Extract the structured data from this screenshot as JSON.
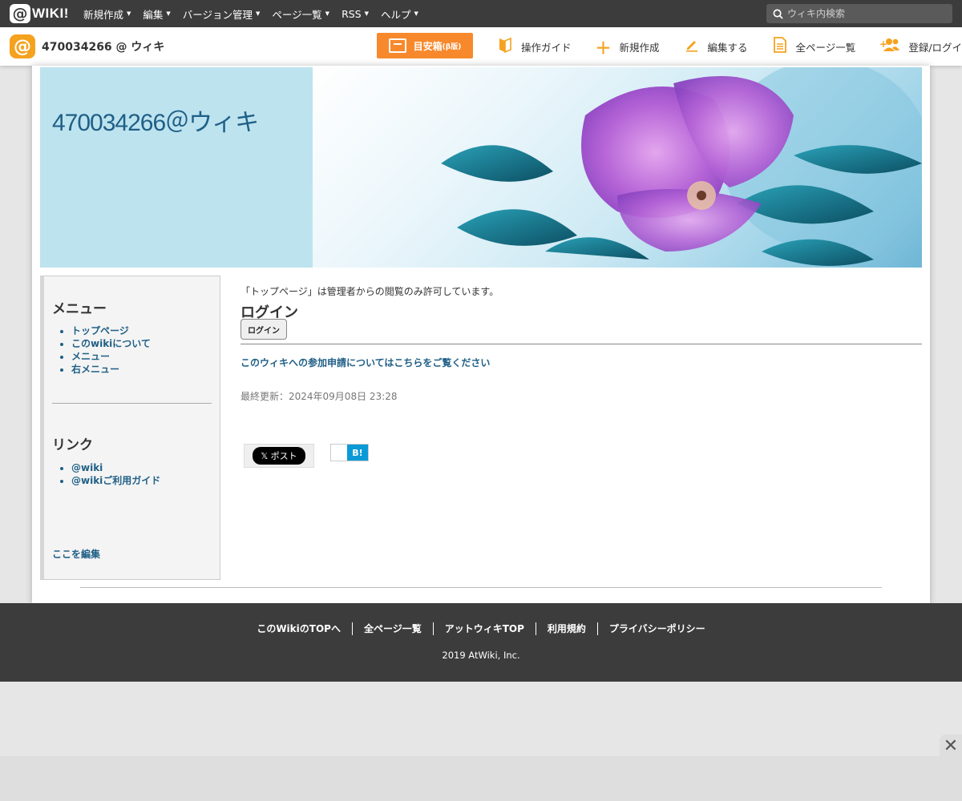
{
  "topbar": {
    "logo_text": "WIKI!",
    "nav": [
      "新規作成",
      "編集",
      "バージョン管理",
      "ページ一覧",
      "RSS",
      "ヘルプ"
    ],
    "search_placeholder": "ウィキ内検索"
  },
  "subbar": {
    "site_name": "470034266 @ ウィキ",
    "guide_label": "目安箱",
    "guide_suffix": "(β版)",
    "actions": [
      "操作ガイド",
      "新規作成",
      "編集する",
      "全ページ一覧",
      "登録/ログイン"
    ]
  },
  "header": {
    "site_title": "470034266＠ウィキ"
  },
  "sidebar": {
    "menu_title": "メニュー",
    "menu_items": [
      "トップページ",
      "このwikiについて",
      "メニュー",
      "右メニュー"
    ],
    "links_title": "リンク",
    "link_items": [
      "@wiki",
      "@wikiご利用ガイド"
    ],
    "edit_label": "ここを編集"
  },
  "main": {
    "notice": "「トップページ」は管理者からの閲覧のみ許可しています。",
    "heading": "ログイン",
    "login_button": "ログイン",
    "join_link": "このウィキへの参加申請についてはこちらをご覧ください",
    "updated": "最終更新：2024年09月08日 23:28",
    "share_x": "𝕏 ポスト",
    "share_hatena": "B!"
  },
  "footer": {
    "links": [
      "このWikiのTOPへ",
      "全ページ一覧",
      "アットウィキTOP",
      "利用規約",
      "プライバシーポリシー"
    ],
    "copyright": "2019 AtWiki, Inc."
  },
  "colors": {
    "accent": "#f5a21f",
    "guide_button": "#f7892c",
    "link": "#1f5f86",
    "dark_bar": "#3c3c3c",
    "header_bg": "#bde3ef"
  }
}
